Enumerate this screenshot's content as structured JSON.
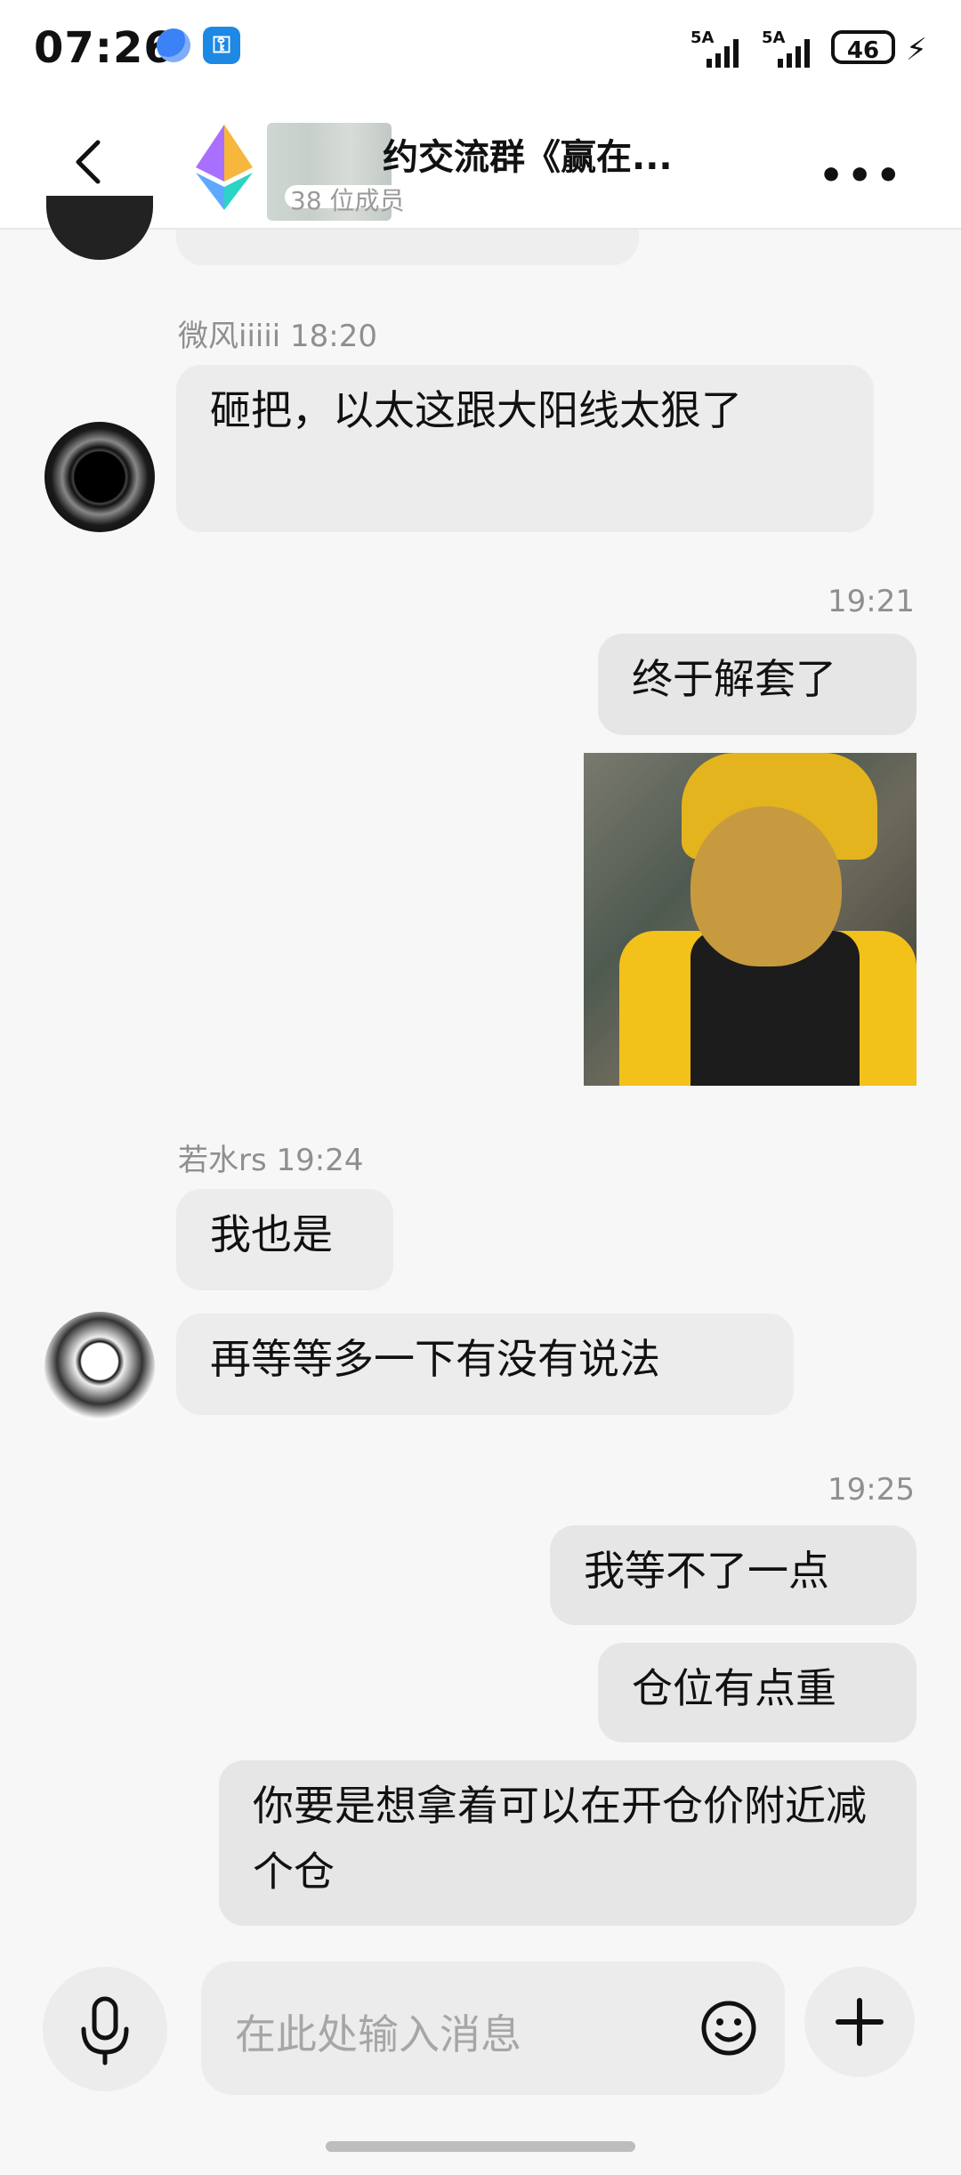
{
  "status_bar": {
    "time": "07:26",
    "signal_1_label": "5A",
    "signal_2_label": "5A",
    "battery": "46"
  },
  "header": {
    "title": "约交流群《赢在...",
    "subtitle": "38 位成员"
  },
  "messages": [
    {
      "type": "sender",
      "text": "微风iiiii 18:20"
    },
    {
      "type": "incoming",
      "text": "砸把，以太这跟大阳线太狠了"
    },
    {
      "type": "time",
      "text": "19:21"
    },
    {
      "type": "outgoing",
      "text": "终于解套了"
    },
    {
      "type": "sender",
      "text": "若水rs 19:24"
    },
    {
      "type": "incoming",
      "text": "我也是"
    },
    {
      "type": "incoming",
      "text": "再等等多一下有没有说法"
    },
    {
      "type": "time",
      "text": "19:25"
    },
    {
      "type": "outgoing",
      "text": "我等不了一点"
    },
    {
      "type": "outgoing",
      "text": "仓位有点重"
    },
    {
      "type": "outgoing",
      "text": "你要是想拿着可以在开仓价附近减个仓"
    }
  ],
  "input": {
    "placeholder": "在此处输入消息"
  },
  "colors": {
    "bubble": "#ececec",
    "background": "#f7f7f7",
    "header_bg": "#ffffff"
  }
}
